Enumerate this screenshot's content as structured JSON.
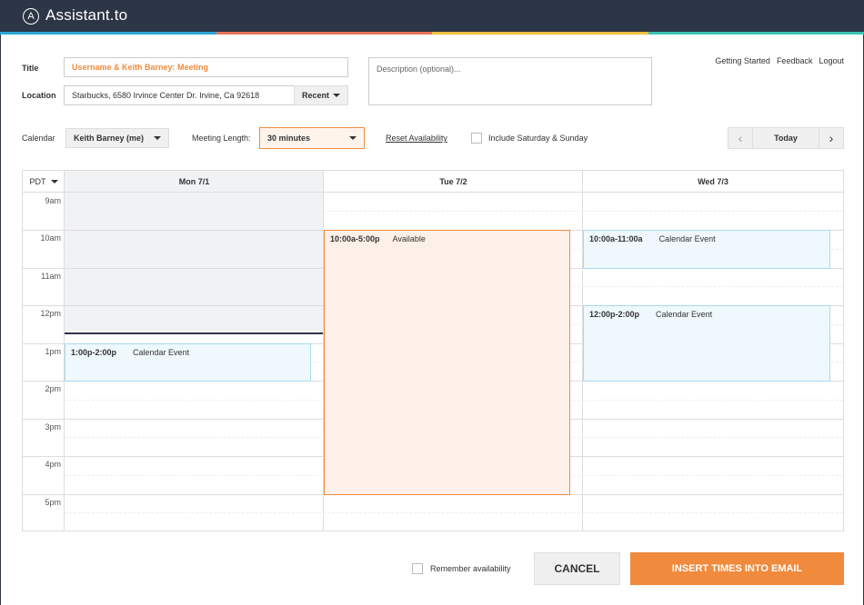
{
  "app": {
    "brand": "Assistant.to",
    "logo_letter": "A",
    "stripe_colors": [
      "#2aa6d8",
      "#e8735a",
      "#f0c040",
      "#3cc4b4"
    ]
  },
  "nav_links": [
    "Getting Started",
    "Feedback",
    "Logout"
  ],
  "form": {
    "title_label": "Title",
    "title_value": "Username & Keith Barney: Meeting",
    "location_label": "Location",
    "location_value": "Starbucks, 6580 Irvince Center Dr. Irvine, Ca 92618",
    "recent_label": "Recent",
    "description_placeholder": "Description (optional)..."
  },
  "controls": {
    "calendar_label": "Calendar",
    "calendar_value": "Keith Barney (me)",
    "meeting_length_label": "Meeting Length:",
    "meeting_length_value": "30 minutes",
    "reset_label": "Reset Availability",
    "weekend_label": "Include Saturday & Sunday",
    "today_label": "Today",
    "prev_icon": "‹",
    "next_icon": "›"
  },
  "calendar": {
    "timezone": "PDT",
    "days": [
      "Mon 7/1",
      "Tue 7/2",
      "Wed 7/3"
    ],
    "hours": [
      "9am",
      "10am",
      "11am",
      "12pm",
      "1pm",
      "2pm",
      "3pm",
      "4pm",
      "5pm"
    ],
    "events": [
      {
        "day": "Mon 7/1",
        "time": "1:00p-2:00p",
        "label": "Calendar Event",
        "kind": "event"
      },
      {
        "day": "Tue 7/2",
        "time": "10:00a-5:00p",
        "label": "Available",
        "kind": "available"
      },
      {
        "day": "Wed 7/3",
        "time": "10:00a-11:00a",
        "label": "Calendar Event",
        "kind": "event"
      },
      {
        "day": "Wed 7/3",
        "time": "12:00p-2:00p",
        "label": "Calendar Event",
        "kind": "event"
      }
    ]
  },
  "footer": {
    "remember_label": "Remember availability",
    "cancel_label": "CANCEL",
    "insert_label": "INSERT TIMES INTO EMAIL"
  },
  "colors": {
    "accent": "#f08a3c",
    "header_bg": "#2d3646",
    "event_border": "#a9dbf0"
  }
}
